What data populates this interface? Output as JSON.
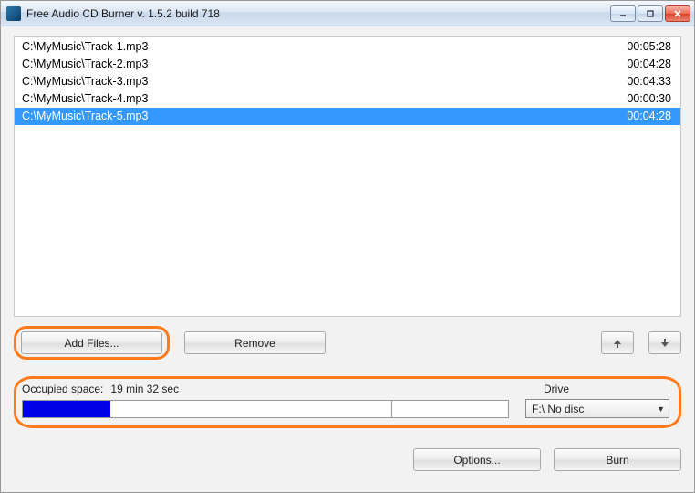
{
  "window": {
    "title": "Free Audio CD Burner  v. 1.5.2 build 718"
  },
  "files": [
    {
      "path": "C:\\MyMusic\\Track-1.mp3",
      "duration": "00:05:28",
      "selected": false
    },
    {
      "path": "C:\\MyMusic\\Track-2.mp3",
      "duration": "00:04:28",
      "selected": false
    },
    {
      "path": "C:\\MyMusic\\Track-3.mp3",
      "duration": "00:04:33",
      "selected": false
    },
    {
      "path": "C:\\MyMusic\\Track-4.mp3",
      "duration": "00:00:30",
      "selected": false
    },
    {
      "path": "C:\\MyMusic\\Track-5.mp3",
      "duration": "00:04:28",
      "selected": true
    }
  ],
  "buttons": {
    "add_files": "Add Files...",
    "remove": "Remove",
    "options": "Options...",
    "burn": "Burn"
  },
  "space": {
    "label": "Occupied space:",
    "value": "19 min 32 sec",
    "fill_percent": 18,
    "tick_percent": 76
  },
  "drive": {
    "label": "Drive",
    "selected": "F:\\ No disc"
  }
}
